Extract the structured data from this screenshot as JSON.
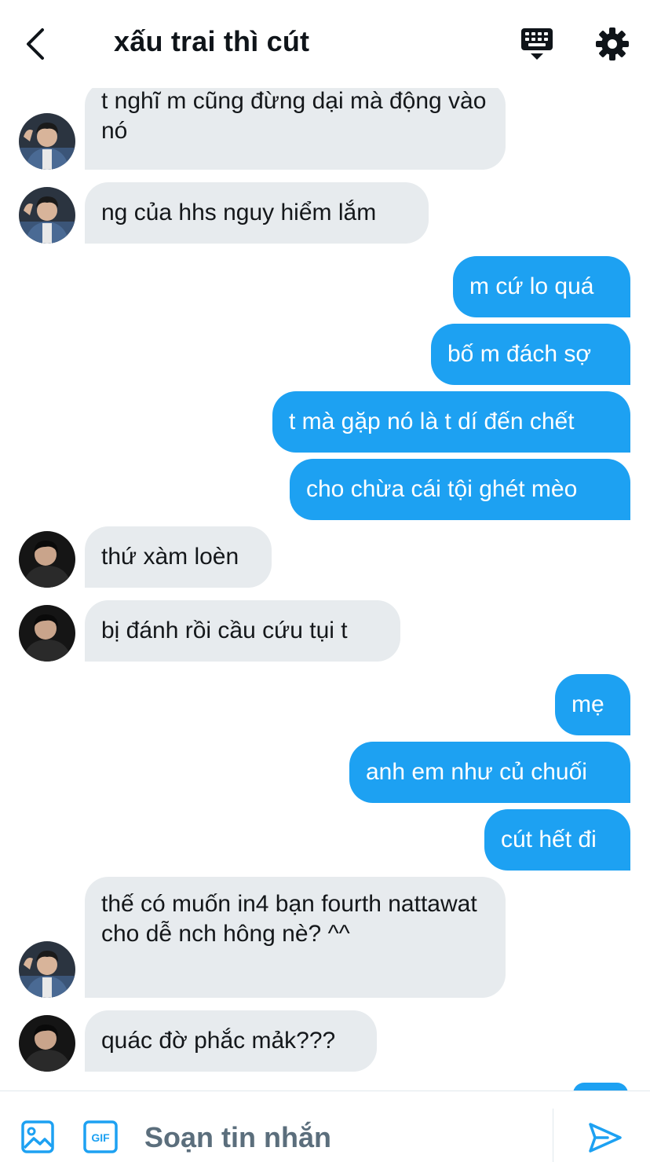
{
  "header": {
    "title": "xấu trai thì cút"
  },
  "messages": [
    {
      "side": "in",
      "sender": "friend-1",
      "text": "t nghĩ m cũng đừng dại mà động vào nó"
    },
    {
      "side": "in",
      "sender": "friend-1",
      "text": "ng của hhs nguy hiểm lắm"
    },
    {
      "side": "out",
      "text": "m cứ lo quá"
    },
    {
      "side": "out",
      "text": "bố m đách sợ"
    },
    {
      "side": "out",
      "text": "t mà gặp nó là t dí đến chết"
    },
    {
      "side": "out",
      "text": "cho chừa cái tội ghét mèo"
    },
    {
      "side": "in",
      "sender": "friend-2",
      "text": "thứ xàm loèn"
    },
    {
      "side": "in",
      "sender": "friend-2",
      "text": "bị đánh rồi cầu cứu tụi t"
    },
    {
      "side": "out",
      "text": "mẹ"
    },
    {
      "side": "out",
      "text": "anh em như củ chuối"
    },
    {
      "side": "out",
      "text": "cút hết đi"
    },
    {
      "side": "in",
      "sender": "friend-1",
      "text": "thế có muốn in4 bạn fourth nattawat cho dễ nch hông nè? ^^"
    },
    {
      "side": "in",
      "sender": "friend-2",
      "text": "quác đờ phắc mảk???"
    }
  ],
  "composer": {
    "placeholder": "Soạn tin nhắn"
  },
  "colors": {
    "outgoing_bubble": "#1da1f2",
    "incoming_bubble": "#e7ebee",
    "icon_blue": "#1da1f2",
    "placeholder_text": "#5b6e7c"
  },
  "icons": [
    "back-arrow-icon",
    "keyboard-icon",
    "gear-icon",
    "image-icon",
    "gif-icon",
    "send-icon"
  ]
}
